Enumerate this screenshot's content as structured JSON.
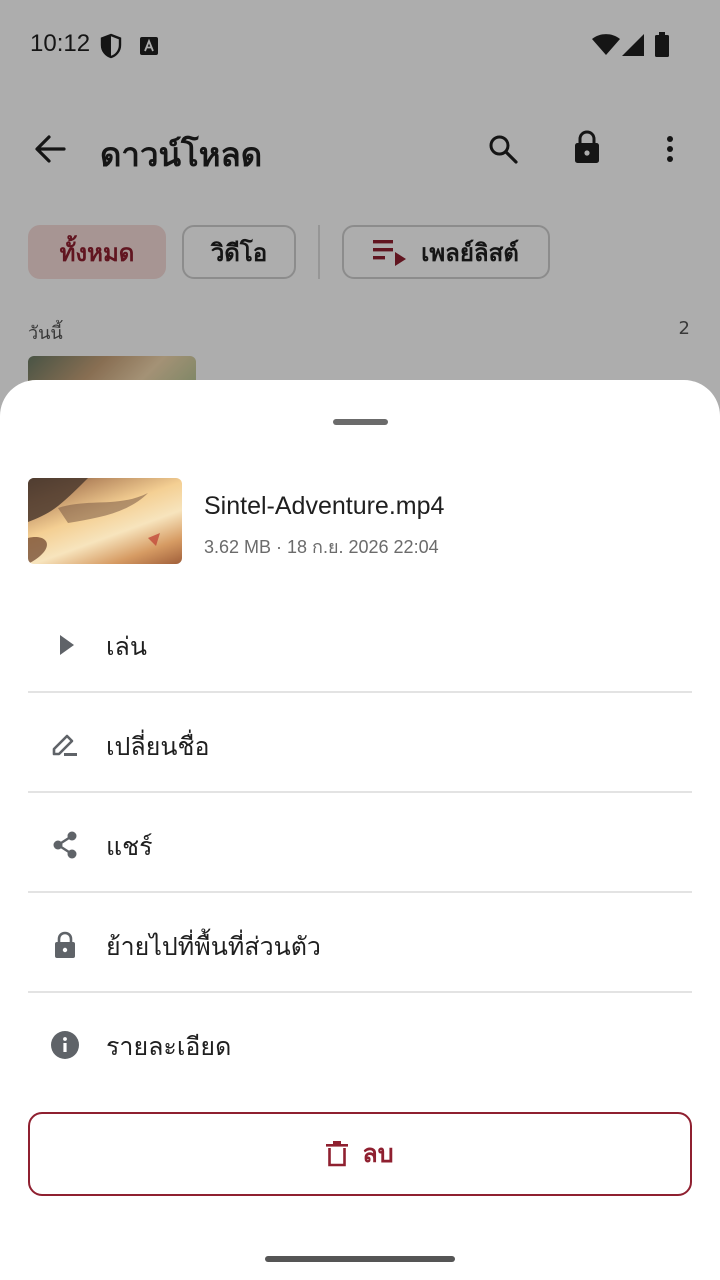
{
  "status_bar": {
    "time": "10:12",
    "icons": [
      "shield-icon",
      "keyboard-a-icon",
      "wifi-icon",
      "signal-icon",
      "battery-icon"
    ]
  },
  "app_bar": {
    "title": "ดาวน์โหลด",
    "icons": [
      "back-arrow-icon",
      "search-icon",
      "lock-icon",
      "more-vert-icon"
    ]
  },
  "filters": {
    "all": "ทั้งหมด",
    "video": "วิดีโอ",
    "playlist": "เพลย์ลิสต์"
  },
  "section": {
    "label": "วันนี้",
    "count": "2"
  },
  "sheet": {
    "file_name": "Sintel-Adventure.mp4",
    "file_meta": "3.62 MB · 18 ก.ย. 2026 22:04",
    "menu": [
      {
        "label": "เล่น",
        "icon": "play-icon"
      },
      {
        "label": "เปลี่ยนชื่อ",
        "icon": "edit-icon"
      },
      {
        "label": "แชร์",
        "icon": "share-icon"
      },
      {
        "label": "ย้ายไปที่พื้นที่ส่วนตัว",
        "icon": "lock-icon"
      },
      {
        "label": "รายละเอียด",
        "icon": "info-icon"
      }
    ],
    "delete_label": "ลบ"
  },
  "colors": {
    "accent": "#8f2030",
    "chip_selected_bg": "#f6dcd9",
    "icon_gray": "#5f6368"
  }
}
